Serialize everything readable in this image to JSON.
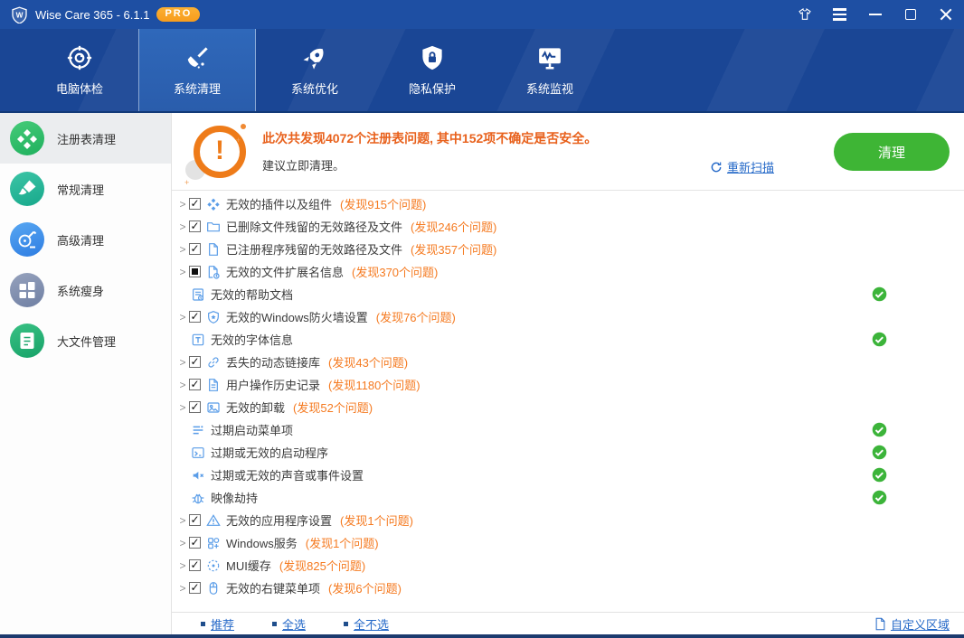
{
  "titlebar": {
    "title": "Wise Care 365 - 6.1.1",
    "badge": "PRO"
  },
  "nav": {
    "tabs": [
      {
        "id": "pc-checkup",
        "icon": "checkup-icon",
        "label": "电脑体检",
        "active": false
      },
      {
        "id": "system-cleaner",
        "icon": "clean-icon",
        "label": "系统清理",
        "active": true
      },
      {
        "id": "system-tuneup",
        "icon": "rocket-icon",
        "label": "系统优化",
        "active": false
      },
      {
        "id": "privacy-protect",
        "icon": "shield-icon",
        "label": "隐私保护",
        "active": false
      },
      {
        "id": "system-monitor",
        "icon": "monitor-icon",
        "label": "系统监视",
        "active": false
      }
    ]
  },
  "sidebar": {
    "items": [
      {
        "id": "registry-cleaner",
        "icon": "registry-icon",
        "label": "注册表清理",
        "active": true,
        "grad": [
          "#46cb79",
          "#1fb05d"
        ]
      },
      {
        "id": "common-cleaner",
        "icon": "brush-icon",
        "label": "常规清理",
        "active": false,
        "grad": [
          "#3cc5a6",
          "#17a88b"
        ]
      },
      {
        "id": "advanced-cleaner",
        "icon": "vacuum-icon",
        "label": "高级清理",
        "active": false,
        "grad": [
          "#58a7f2",
          "#2e7de2"
        ]
      },
      {
        "id": "system-slimming",
        "icon": "windows-icon",
        "label": "系统瘦身",
        "active": false,
        "grad": [
          "#96a2bd",
          "#6f7fa3"
        ]
      },
      {
        "id": "big-files",
        "icon": "bigfiles-icon",
        "label": "大文件管理",
        "active": false,
        "grad": [
          "#39c184",
          "#17a268"
        ]
      }
    ]
  },
  "summary": {
    "headline": "此次共发现4072个注册表问题, 其中152项不确定是否安全。",
    "subline": "建议立即清理。",
    "rescan_label": "重新扫描",
    "clean_label": "清理"
  },
  "list": {
    "rows": [
      {
        "arrow": true,
        "checkbox": "checked",
        "icon": "plugin-icon",
        "label": "无效的插件以及组件",
        "count": "(发现915个问题)",
        "done": false
      },
      {
        "arrow": true,
        "checkbox": "checked",
        "icon": "folder-icon",
        "label": "已删除文件残留的无效路径及文件",
        "count": "(发现246个问题)",
        "done": false
      },
      {
        "arrow": true,
        "checkbox": "checked",
        "icon": "file-icon",
        "label": "已注册程序残留的无效路径及文件",
        "count": "(发现357个问题)",
        "done": false
      },
      {
        "arrow": true,
        "checkbox": "indeterminate",
        "icon": "file-ext-icon",
        "label": "无效的文件扩展名信息",
        "count": "(发现370个问题)",
        "done": false
      },
      {
        "arrow": false,
        "checkbox": "none",
        "icon": "help-doc-icon",
        "label": "无效的帮助文档",
        "count": "",
        "done": true
      },
      {
        "arrow": true,
        "checkbox": "checked",
        "icon": "firewall-icon",
        "label": "无效的Windows防火墙设置",
        "count": "(发现76个问题)",
        "done": false
      },
      {
        "arrow": false,
        "checkbox": "none",
        "icon": "font-icon",
        "label": "无效的字体信息",
        "count": "",
        "done": true
      },
      {
        "arrow": true,
        "checkbox": "checked",
        "icon": "link-icon",
        "label": "丢失的动态链接库",
        "count": "(发现43个问题)",
        "done": false
      },
      {
        "arrow": true,
        "checkbox": "checked",
        "icon": "history-icon",
        "label": "用户操作历史记录",
        "count": "(发现1180个问题)",
        "done": false
      },
      {
        "arrow": true,
        "checkbox": "checked",
        "icon": "uninstall-icon",
        "label": "无效的卸载",
        "count": "(发现52个问题)",
        "done": false
      },
      {
        "arrow": false,
        "checkbox": "none",
        "icon": "startmenu-icon",
        "label": "过期启动菜单项",
        "count": "",
        "done": true
      },
      {
        "arrow": false,
        "checkbox": "none",
        "icon": "startup-icon",
        "label": "过期或无效的启动程序",
        "count": "",
        "done": true
      },
      {
        "arrow": false,
        "checkbox": "none",
        "icon": "sound-icon",
        "label": "过期或无效的声音或事件设置",
        "count": "",
        "done": true
      },
      {
        "arrow": false,
        "checkbox": "none",
        "icon": "bug-icon",
        "label": "映像劫持",
        "count": "",
        "done": true
      },
      {
        "arrow": true,
        "checkbox": "checked",
        "icon": "warning-icon",
        "label": "无效的应用程序设置",
        "count": "(发现1个问题)",
        "done": false
      },
      {
        "arrow": true,
        "checkbox": "checked",
        "icon": "services-icon",
        "label": "Windows服务",
        "count": "(发现1个问题)",
        "done": false
      },
      {
        "arrow": true,
        "checkbox": "checked",
        "icon": "mui-icon",
        "label": "MUI缓存",
        "count": "(发现825个问题)",
        "done": false
      },
      {
        "arrow": true,
        "checkbox": "checked",
        "icon": "contextmenu-icon",
        "label": "无效的右键菜单项",
        "count": "(发现6个问题)",
        "done": false
      }
    ]
  },
  "footer": {
    "links": [
      {
        "id": "recommended",
        "label": "推荐"
      },
      {
        "id": "select-all",
        "label": "全选"
      },
      {
        "id": "select-none",
        "label": "全不选"
      }
    ],
    "custom_label": "自定义区域"
  },
  "colors": {
    "titlebar_blue": "#1e4fa3",
    "nav_blue": "#1a4695",
    "nav_active_blue": "#2f68ba",
    "headline_orange": "#e8611c",
    "count_orange": "#f57a20",
    "clean_green": "#3eb535",
    "status_green": "#3cb43a",
    "link_blue": "#2569c8",
    "pro_badge_orange": "#f79c1d",
    "row_icon_blue": "#5a9de8"
  }
}
